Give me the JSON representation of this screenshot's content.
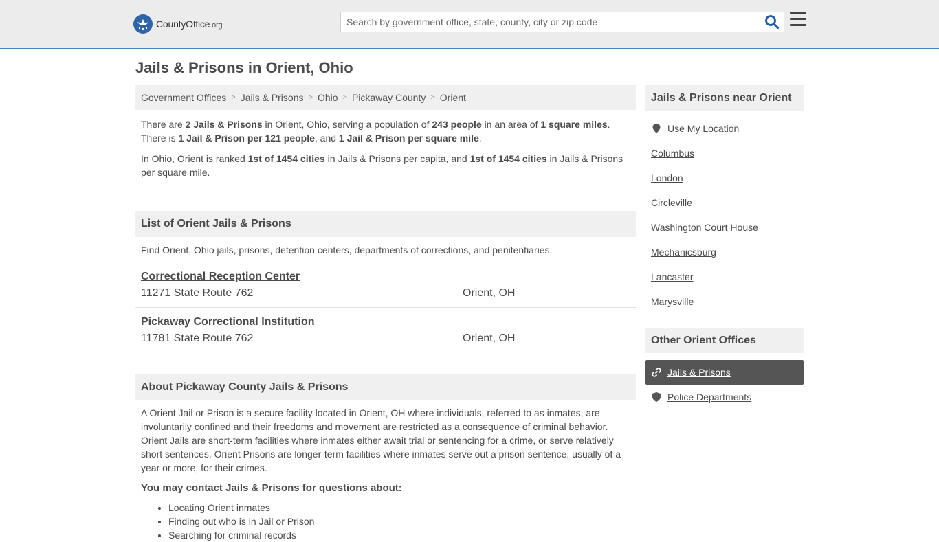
{
  "header": {
    "logo_main": "CountyOffice",
    "logo_domain": ".org",
    "search_placeholder": "Search by government office, state, county, city or zip code"
  },
  "page_title": "Jails & Prisons in Orient, Ohio",
  "breadcrumb": [
    "Government Offices",
    "Jails & Prisons",
    "Ohio",
    "Pickaway County",
    "Orient"
  ],
  "intro": {
    "p1": [
      {
        "t": "There are ",
        "b": false
      },
      {
        "t": "2 Jails & Prisons",
        "b": true
      },
      {
        "t": " in Orient, Ohio, serving a population of ",
        "b": false
      },
      {
        "t": "243 people",
        "b": true
      },
      {
        "t": " in an area of ",
        "b": false
      },
      {
        "t": "1 square miles",
        "b": true
      },
      {
        "t": ". There is ",
        "b": false
      },
      {
        "t": "1 Jail & Prison per 121 people",
        "b": true
      },
      {
        "t": ", and ",
        "b": false
      },
      {
        "t": "1 Jail & Prison per square mile",
        "b": true
      },
      {
        "t": ".",
        "b": false
      }
    ],
    "p2": [
      {
        "t": "In Ohio, Orient is ranked ",
        "b": false
      },
      {
        "t": "1st of 1454 cities",
        "b": true
      },
      {
        "t": " in Jails & Prisons per capita, and ",
        "b": false
      },
      {
        "t": "1st of 1454 cities",
        "b": true
      },
      {
        "t": " in Jails & Prisons per square mile.",
        "b": false
      }
    ]
  },
  "list_section": {
    "heading": "List of Orient Jails & Prisons",
    "description": "Find Orient, Ohio jails, prisons, detention centers, departments of corrections, and penitentiaries.",
    "items": [
      {
        "name": "Correctional Reception Center",
        "address": "11271 State Route 762",
        "city": "Orient, OH"
      },
      {
        "name": "Pickaway Correctional Institution",
        "address": "11781 State Route 762",
        "city": "Orient, OH"
      }
    ]
  },
  "about": {
    "heading": "About Pickaway County Jails & Prisons",
    "paragraph": "A Orient Jail or Prison is a secure facility located in Orient, OH where individuals, referred to as inmates, are involuntarily confined and their freedoms and movement are restricted as a consequence of criminal behavior. Orient Jails are short-term facilities where inmates either await trial or sentencing for a crime, or serve relatively short sentences. Orient Prisons are longer-term facilities where inmates serve out a prison sentence, usually of a year or more, for their crimes.",
    "contact_heading": "You may contact Jails & Prisons for questions about:",
    "bullets": [
      "Locating Orient inmates",
      "Finding out who is in Jail or Prison",
      "Searching for criminal records"
    ]
  },
  "sidebar": {
    "near_heading": "Jails & Prisons near Orient",
    "use_location": "Use My Location",
    "near_links": [
      "Columbus",
      "London",
      "Circleville",
      "Washington Court House",
      "Mechanicsburg",
      "Lancaster",
      "Marysville"
    ],
    "other_heading": "Other Orient Offices",
    "other_links": [
      {
        "label": "Jails & Prisons",
        "icon": "link-icon",
        "active": true
      },
      {
        "label": "Police Departments",
        "icon": "shield-icon",
        "active": false
      }
    ]
  },
  "colors": {
    "accent_border": "#4a7fc1",
    "logo_blue": "#2f65a8",
    "search_icon": "#1d5aa8",
    "active_bg": "#555555"
  }
}
